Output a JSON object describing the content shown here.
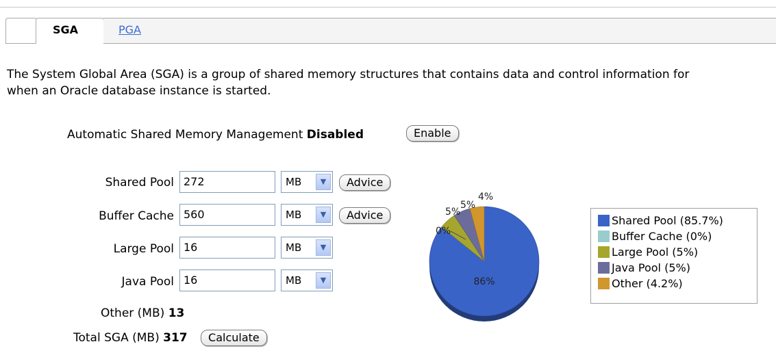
{
  "tabs": [
    {
      "label": "SGA",
      "active": true
    },
    {
      "label": "PGA",
      "active": false
    }
  ],
  "description": {
    "line1": "The System Global Area (SGA) is a group of shared memory structures that contains data and control information for",
    "line2": "when an Oracle database instance is started."
  },
  "asmm": {
    "label": "Automatic Shared Memory Management",
    "status": "Disabled",
    "button": "Enable"
  },
  "components": [
    {
      "label": "Shared Pool",
      "value": "272",
      "unit": "MB",
      "advice": "Advice"
    },
    {
      "label": "Buffer Cache",
      "value": "560",
      "unit": "MB",
      "advice": "Advice"
    },
    {
      "label": "Large Pool",
      "value": "16",
      "unit": "MB"
    },
    {
      "label": "Java Pool",
      "value": "16",
      "unit": "MB"
    }
  ],
  "other": {
    "label": "Other (MB)",
    "value": "13"
  },
  "total": {
    "label": "Total SGA (MB)",
    "value": "317",
    "button": "Calculate"
  },
  "chart_data": {
    "type": "pie",
    "slices": [
      {
        "name": "Shared Pool (85.7%)",
        "value": 85.7,
        "label": "86%",
        "color": "#3a63c8"
      },
      {
        "name": "Buffer Cache (0%)",
        "value": 0,
        "label": "0%",
        "color": "#99cccc"
      },
      {
        "name": "Large Pool (5%)",
        "value": 5,
        "label": "5%",
        "color": "#a6a62e"
      },
      {
        "name": "Java Pool (5%)",
        "value": 5,
        "label": "5%",
        "color": "#6c6c9c"
      },
      {
        "name": "Other (4.2%)",
        "value": 4.2,
        "label": "4%",
        "color": "#d1962e"
      }
    ],
    "legend_position": "right"
  }
}
